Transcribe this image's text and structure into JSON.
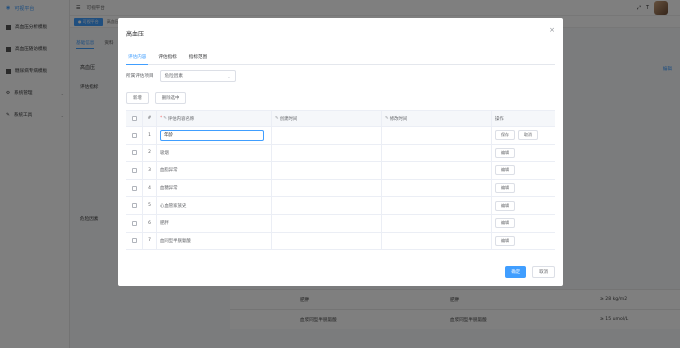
{
  "sidebar": {
    "logo_label": "可视平台",
    "items": [
      {
        "label": "高血压分析模板"
      },
      {
        "label": "高血压随访模板"
      },
      {
        "label": "糖尿病专病模板"
      },
      {
        "label": "系统管理"
      },
      {
        "label": "系统工具"
      }
    ]
  },
  "topbar": {
    "breadcrumb": "可视平台"
  },
  "tagsbar": {
    "active_tag": "● 可视平台",
    "tag2": "高血压"
  },
  "content": {
    "tabs": [
      "基础信息",
      "资料",
      "量表"
    ],
    "title": "高血压",
    "label1": "评估指标",
    "label2": "危险因素",
    "edit": "编辑",
    "rows": [
      {
        "col1": "肥胖",
        "col2": "肥胖",
        "col3": "≥ 28 kg/m2"
      },
      {
        "col1": "血浆同型半胱氨酸",
        "col2": "血浆同型半胱氨酸",
        "col3": "≥ 15 umol/L"
      }
    ]
  },
  "modal": {
    "title": "高血压",
    "close": "×",
    "tabs": [
      {
        "label": "评估内容",
        "active": true
      },
      {
        "label": "评估指标",
        "active": false
      },
      {
        "label": "指标范围",
        "active": false
      }
    ],
    "form": {
      "label": "所属评估项目",
      "selected": "危险因素"
    },
    "buttons": {
      "add": "新增",
      "delete": "删除选中"
    },
    "table": {
      "headers": {
        "index": "#",
        "name": "评估内容名称",
        "created": "创建时间",
        "modified": "修改时间",
        "action": "操作"
      },
      "rows": [
        {
          "index": "1",
          "name": "年龄",
          "editing": true
        },
        {
          "index": "2",
          "name": "吸烟"
        },
        {
          "index": "3",
          "name": "血脂异常"
        },
        {
          "index": "4",
          "name": "血糖异常"
        },
        {
          "index": "5",
          "name": "心血管家族史"
        },
        {
          "index": "6",
          "name": "肥胖"
        },
        {
          "index": "7",
          "name": "血同型半胱氨酸"
        }
      ],
      "save": "保存",
      "cancel": "取消",
      "edit": "编辑"
    },
    "footer": {
      "confirm": "确定",
      "cancel": "取消"
    }
  },
  "colors": {
    "primary": "#409eff",
    "overlay": "rgba(0,0,0,0.5)"
  }
}
